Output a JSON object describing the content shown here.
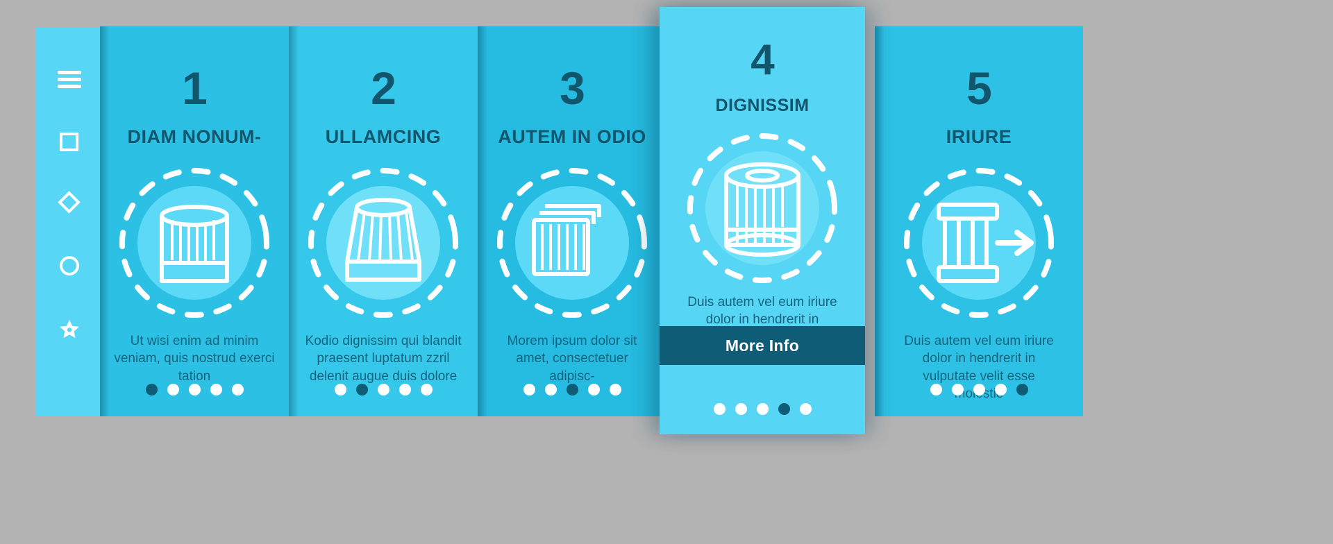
{
  "sidebar": {
    "items": [
      {
        "icon": "hamburger-menu-icon",
        "label": ""
      },
      {
        "icon": "square-icon",
        "label": ""
      },
      {
        "icon": "diamond-icon",
        "label": ""
      },
      {
        "icon": "circle-icon",
        "label": ""
      },
      {
        "icon": "star-icon",
        "label": ""
      }
    ]
  },
  "colors": {
    "background": "#b3b3b3",
    "sidebar": "#57d6f5",
    "panel": "#2cc1e4",
    "panel_alt": "#35c8ea",
    "panel_featured": "#56d5f4",
    "dark_text": "#12566e",
    "body_text": "#16647e",
    "button": "#0e5c76",
    "white": "#ffffff"
  },
  "panels": [
    {
      "number": "1",
      "title": "DIAM NONUM-",
      "icon": "filter-cartridge-icon",
      "body": "Ut wisi enim ad minim veniam, quis nostrud exerci tation",
      "dots_total": 5,
      "dots_active": 1,
      "featured": false
    },
    {
      "number": "2",
      "title": "ULLAMCING",
      "icon": "cone-air-filter-icon",
      "body": "Kodio dignissim qui blandit praesent luptatum zzril delenit augue duis dolore",
      "dots_total": 5,
      "dots_active": 2,
      "featured": false
    },
    {
      "number": "3",
      "title": "AUTEM IN ODIO",
      "icon": "stacked-panel-filters-icon",
      "body": "Morem ipsum dolor sit amet, consectetuer adipisc-",
      "dots_total": 5,
      "dots_active": 3,
      "featured": false
    },
    {
      "number": "4",
      "title": "DIGNISSIM",
      "icon": "cylinder-oil-filter-icon",
      "body": "Duis autem vel eum iriure dolor in hendrerit in",
      "button_label": "More Info",
      "dots_total": 5,
      "dots_active": 4,
      "featured": true
    },
    {
      "number": "5",
      "title": "IRIURE",
      "icon": "filter-airflow-arrow-icon",
      "body": "Duis autem vel eum iriure dolor in hendrerit in vulputate velit esse molestie",
      "dots_total": 5,
      "dots_active": 5,
      "featured": false
    }
  ]
}
